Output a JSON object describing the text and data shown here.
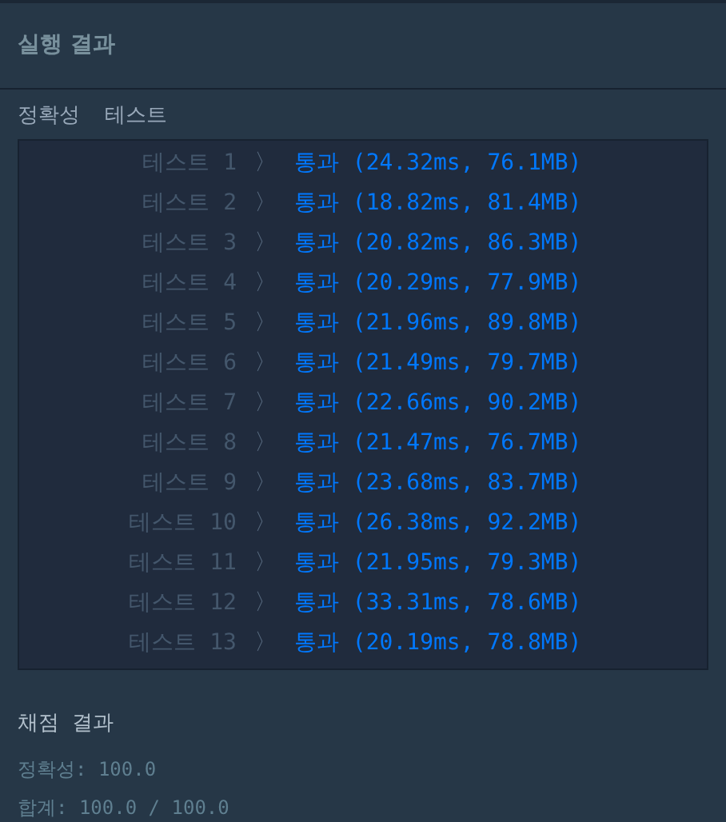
{
  "title": "실행 결과",
  "section_label": "정확성  테스트",
  "tests": [
    {
      "label": "테스트 1",
      "separator": "〉",
      "result": "통과 (24.32ms, 76.1MB)"
    },
    {
      "label": "테스트 2",
      "separator": "〉",
      "result": "통과 (18.82ms, 81.4MB)"
    },
    {
      "label": "테스트 3",
      "separator": "〉",
      "result": "통과 (20.82ms, 86.3MB)"
    },
    {
      "label": "테스트 4",
      "separator": "〉",
      "result": "통과 (20.29ms, 77.9MB)"
    },
    {
      "label": "테스트 5",
      "separator": "〉",
      "result": "통과 (21.96ms, 89.8MB)"
    },
    {
      "label": "테스트 6",
      "separator": "〉",
      "result": "통과 (21.49ms, 79.7MB)"
    },
    {
      "label": "테스트 7",
      "separator": "〉",
      "result": "통과 (22.66ms, 90.2MB)"
    },
    {
      "label": "테스트 8",
      "separator": "〉",
      "result": "통과 (21.47ms, 76.7MB)"
    },
    {
      "label": "테스트 9",
      "separator": "〉",
      "result": "통과 (23.68ms, 83.7MB)"
    },
    {
      "label": "테스트 10",
      "separator": "〉",
      "result": "통과 (26.38ms, 92.2MB)"
    },
    {
      "label": "테스트 11",
      "separator": "〉",
      "result": "통과 (21.95ms, 79.3MB)"
    },
    {
      "label": "테스트 12",
      "separator": "〉",
      "result": "통과 (33.31ms, 78.6MB)"
    },
    {
      "label": "테스트 13",
      "separator": "〉",
      "result": "통과 (20.19ms, 78.8MB)"
    }
  ],
  "summary": {
    "title": "채점 결과",
    "lines": [
      "정확성: 100.0",
      "합계: 100.0 / 100.0"
    ]
  }
}
